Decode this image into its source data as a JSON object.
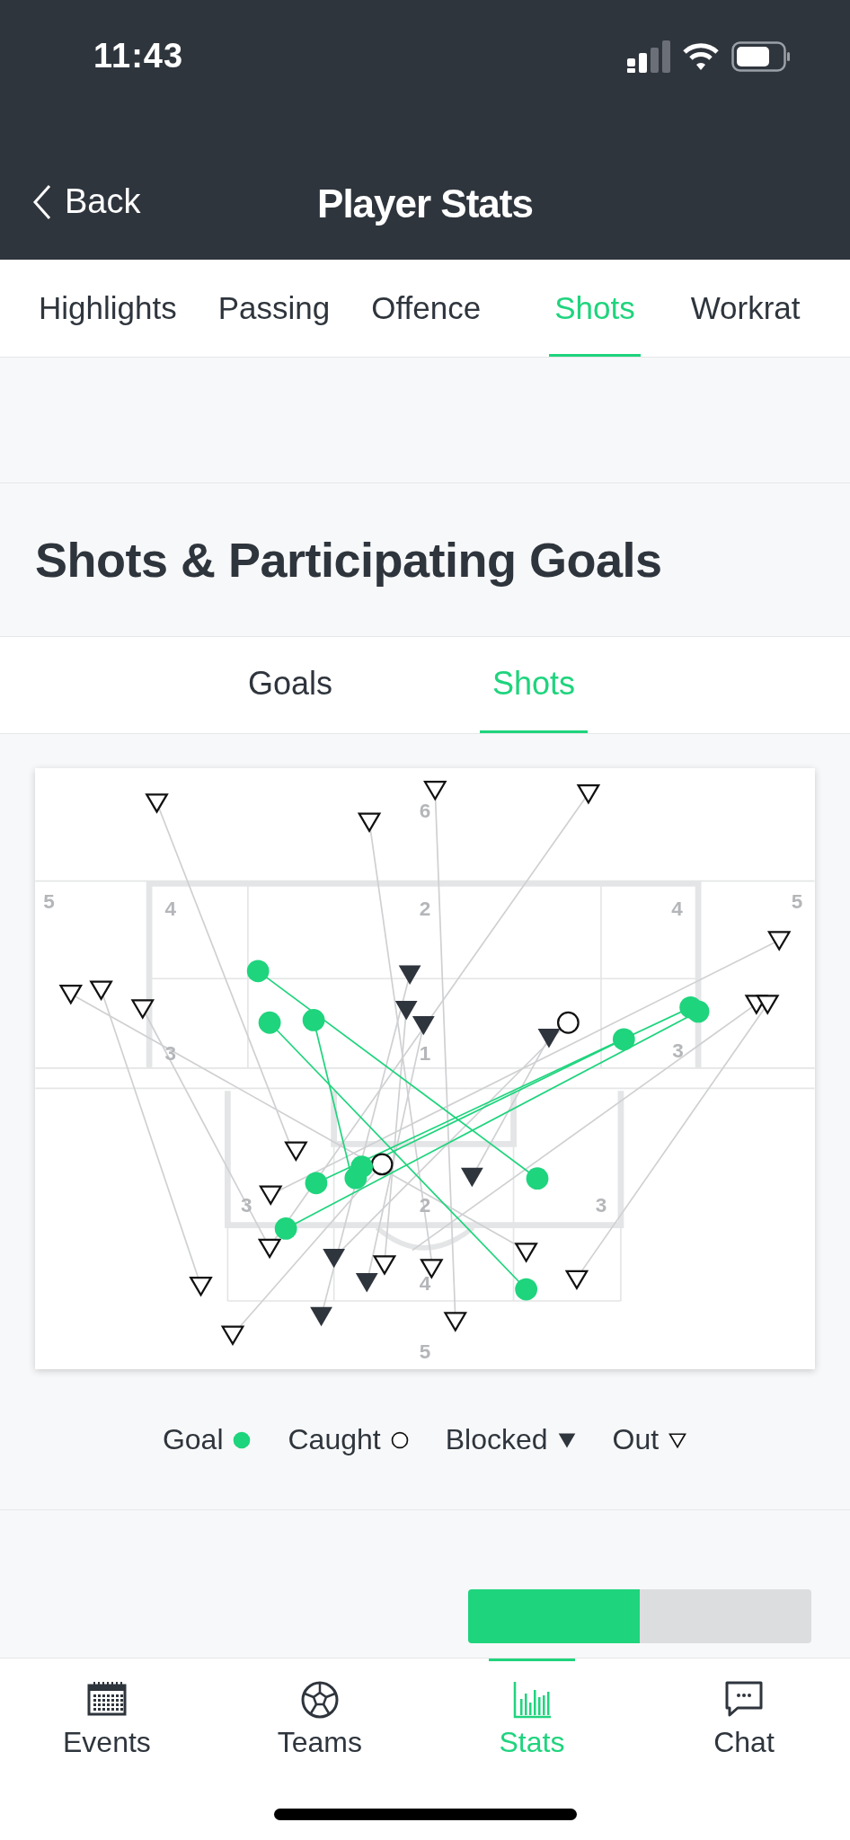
{
  "status_bar": {
    "time": "11:43"
  },
  "nav_bar": {
    "back": "Back",
    "title": "Player Stats"
  },
  "tabs": [
    {
      "label": "Highlights",
      "selected": false
    },
    {
      "label": "Passing",
      "selected": false
    },
    {
      "label": "Offence",
      "selected": false
    },
    {
      "label": "Shots",
      "selected": true
    },
    {
      "label": "Workrat",
      "selected": false
    }
  ],
  "section": {
    "title": "Shots & Participating Goals",
    "subtabs": [
      {
        "label": "Goals",
        "selected": false
      },
      {
        "label": "Shots",
        "selected": true
      }
    ],
    "shot_map": {
      "zone_labels": [
        "6",
        "5",
        "4",
        "2",
        "4",
        "5",
        "3",
        "1",
        "3",
        "3",
        "2",
        "3",
        "4",
        "5"
      ],
      "shots": [
        {
          "kind": "out"
        },
        {
          "kind": "out"
        },
        {
          "kind": "out"
        },
        {
          "kind": "out"
        },
        {
          "kind": "out"
        },
        {
          "kind": "out"
        },
        {
          "kind": "out"
        },
        {
          "kind": "out"
        },
        {
          "kind": "out"
        },
        {
          "kind": "out"
        },
        {
          "kind": "out"
        },
        {
          "kind": "out"
        },
        {
          "kind": "out"
        },
        {
          "kind": "out"
        },
        {
          "kind": "out"
        },
        {
          "kind": "out"
        },
        {
          "kind": "out"
        },
        {
          "kind": "out"
        },
        {
          "kind": "out"
        },
        {
          "kind": "out"
        },
        {
          "kind": "blocked"
        },
        {
          "kind": "blocked"
        },
        {
          "kind": "blocked"
        },
        {
          "kind": "blocked"
        },
        {
          "kind": "blocked"
        },
        {
          "kind": "blocked"
        },
        {
          "kind": "blocked"
        },
        {
          "kind": "blocked"
        },
        {
          "kind": "caught"
        },
        {
          "kind": "caught"
        },
        {
          "kind": "goal"
        },
        {
          "kind": "goal"
        },
        {
          "kind": "goal"
        },
        {
          "kind": "goal"
        },
        {
          "kind": "goal"
        },
        {
          "kind": "goal"
        },
        {
          "kind": "goal"
        },
        {
          "kind": "goal"
        },
        {
          "kind": "goal"
        },
        {
          "kind": "goal"
        },
        {
          "kind": "goal"
        },
        {
          "kind": "goal"
        }
      ]
    },
    "legend": [
      {
        "label": "Goal",
        "kind": "goal"
      },
      {
        "label": "Caught",
        "kind": "caught"
      },
      {
        "label": "Blocked",
        "kind": "blocked"
      },
      {
        "label": "Out",
        "kind": "out"
      }
    ]
  },
  "workrate_toggle": [
    {
      "selected": true
    },
    {
      "selected": false
    }
  ],
  "tab_bar": [
    {
      "label": "Events",
      "selected": false
    },
    {
      "label": "Teams",
      "selected": false
    },
    {
      "label": "Stats",
      "selected": true
    },
    {
      "label": "Chat",
      "selected": false
    }
  ]
}
